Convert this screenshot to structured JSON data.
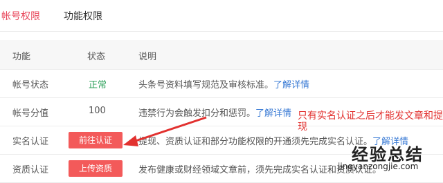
{
  "tabs": [
    {
      "label": "帐号权限"
    },
    {
      "label": "功能权限"
    }
  ],
  "table": {
    "headers": [
      "功能",
      "状态",
      "说明"
    ],
    "rows": [
      {
        "feature": "帐号状态",
        "status": "正常",
        "desc": "头条号资料填写规范及审核标准。",
        "link": "了解详情"
      },
      {
        "feature": "帐号分值",
        "status": "100",
        "desc": "违禁行为会触发扣分和惩罚。",
        "link": "了解详情"
      },
      {
        "feature": "实名认证",
        "button": "前往认证",
        "desc": "提现、资质认证和部分功能权限的开通须先完成实名认证。",
        "link": "了解详情"
      },
      {
        "feature": "资质认证",
        "button": "上传资质",
        "desc": "发布健康或财经领域文章前，须先完成实名认证和资质认证。",
        "link": ""
      }
    ]
  },
  "annotation": "只有实名认证之后才能发文章和提现",
  "watermark": {
    "text": "经验总结",
    "url": "jingyanzongjie.com"
  },
  "colors": {
    "accent": "#e8465a",
    "button": "#f35a5a",
    "status_ok": "#2ca05a",
    "link": "#3a7bd5",
    "annotation": "#e2312f"
  }
}
